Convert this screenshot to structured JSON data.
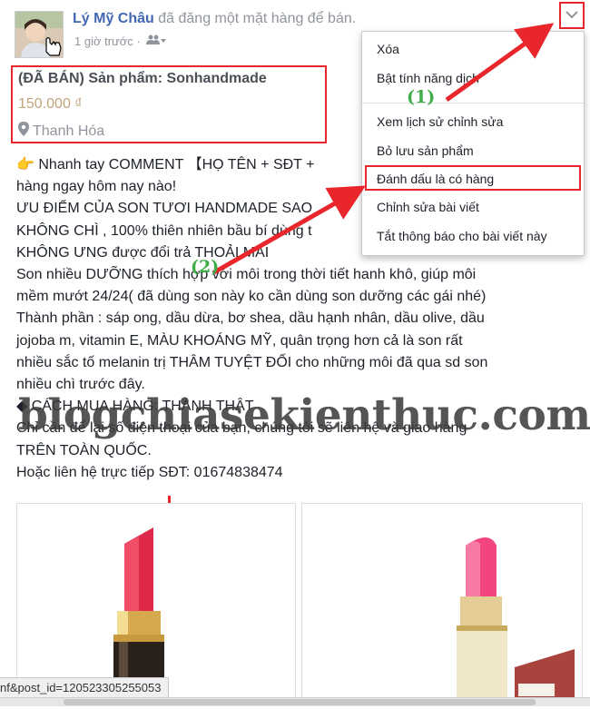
{
  "post": {
    "author_name": "Lý Mỹ Châu",
    "action_text": "đã đăng một mặt hàng để bán.",
    "time": "1 giờ trước ·",
    "sale_title": "(ĐÃ BÁN) Sản phẩm: Sonhandmade",
    "price": "150.000 ₫",
    "location": "Thanh Hóa",
    "body_lines": [
      "👉 Nhanh tay COMMENT 【HỌ TÊN + SĐT +",
      "hàng ngay hôm nay nào!",
      "ƯU ĐIỂM CỦA SON TƯƠI HANDMADE SAO",
      "KHÔNG CHÌ , 100% thiên nhiên bầu bí dùng t",
      "KHÔNG ƯNG được đổi trả THOẢI MÁI",
      "Son nhiều DƯỠNG thích hợp với môi trong thời tiết hanh khô, giúp môi",
      "mềm mướt 24/24( đã dùng son này ko cần dùng son dưỡng các gái nhé)",
      "Thành phần : sáp ong, dầu dừa, bơ shea, dầu hạnh nhân, dầu olive, dầu",
      "jojoba m, vitamin E, MÀU KHOÁNG MỸ, quân trọng hơn cả là son rất",
      "nhiều sắc tố melanin trị THÂM TUYỆT ĐỐI cho những môi đã qua sd son",
      "nhiều chì trước đây.",
      "◆ CÁCH MUA HÀNG: THÀNH THẬT",
      "Chỉ cần để lại số điện thoại của bạn, chúng tôi sẽ liên hệ và giao hàng",
      "TRÊN TOÀN QUỐC.",
      "Hoặc liên hệ trực tiếp SĐT: 01674838474"
    ]
  },
  "menu": {
    "items": [
      "Xóa",
      "Bật tính năng dịch",
      "Xem lịch sử chỉnh sửa",
      "Bỏ lưu sản phẩm",
      "Đánh dấu là có hàng",
      "Chỉnh sửa bài viết",
      "Tắt thông báo cho bài viết này"
    ]
  },
  "annotations": {
    "step1": "(1)",
    "step2": "(2)",
    "watermark": "blogchiasekienthuc.com"
  },
  "statusbar": {
    "url": "nf&post_id=120523305255053"
  },
  "colors": {
    "link_blue": "#4267b2",
    "annotation_red": "#e8262b",
    "annotation_green": "#3fae49",
    "lipstick_1": "#e0284a",
    "lipstick_2": "#f2457f"
  },
  "icons": [
    "cursor-hand-icon",
    "audience-friends-icon",
    "chevron-down-icon",
    "location-pin-icon"
  ]
}
